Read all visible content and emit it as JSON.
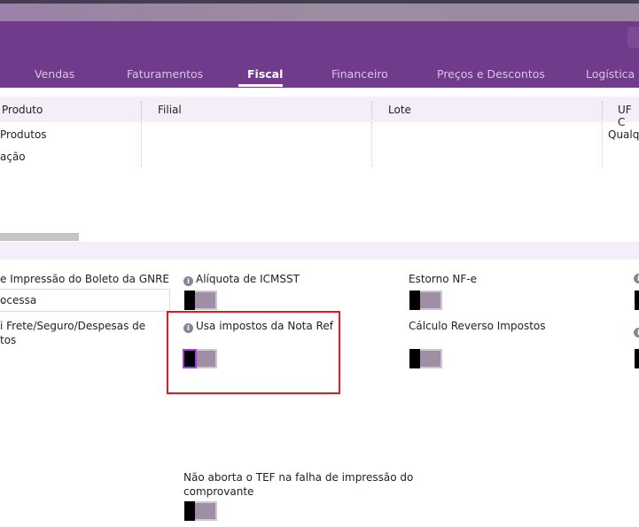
{
  "tabs": [
    {
      "label": "Vendas"
    },
    {
      "label": "Faturamentos"
    },
    {
      "label": "Fiscal",
      "active": true
    },
    {
      "label": "Financeiro"
    },
    {
      "label": "Preços e Descontos"
    },
    {
      "label": "Logística"
    }
  ],
  "table": {
    "headers": [
      "Produto",
      "Filial",
      "Lote",
      "UF C"
    ],
    "rows": [
      [
        "Produtos",
        "",
        "",
        "Qualqu"
      ],
      [
        "ação",
        "",
        "",
        ""
      ]
    ]
  },
  "form": {
    "gnre_label": "e Impressão do Boleto da GNRE",
    "gnre_value": "ocessa",
    "frete_label": "i Frete/Seguro/Despesas de",
    "frete_label2": "tos",
    "aliquota_label": "Alíquota de ICMSST",
    "usa_impostos_label": "Usa impostos da Nota Ref",
    "estorno_label": "Estorno NF-e",
    "calculo_label": "Cálculo Reverso Impostos",
    "tef_label": "Não aborta o TEF na falha de impressão do",
    "tef_label2": "comprovante"
  },
  "toggles": {
    "aliquota": false,
    "usa_impostos": false,
    "estorno": false,
    "calculo": false,
    "tef": false
  },
  "colors": {
    "header": "#6f3b8a",
    "highlight": "#e21a1a",
    "focus": "#a43ee0"
  },
  "icons": {
    "info": "info-circle-icon",
    "chevron": "chevron-down-icon"
  }
}
